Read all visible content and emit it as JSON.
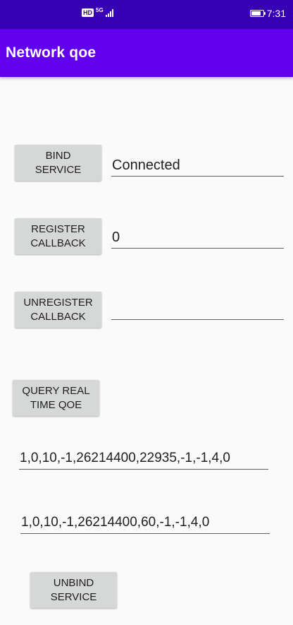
{
  "status_bar": {
    "hd_label": "HD",
    "network_type": "5G",
    "time": "7:31",
    "battery_level": 0.8
  },
  "app_bar": {
    "title": "Network qoe"
  },
  "bind": {
    "button_label": "BIND\nSERVICE",
    "status_value": "Connected"
  },
  "register": {
    "button_label": "REGISTER\nCALLBACK",
    "value": "0"
  },
  "unregister": {
    "button_label": "UNREGISTER\nCALLBACK",
    "value": ""
  },
  "query": {
    "button_label": "QUERY REAL\nTIME QOE",
    "result_1": "1,0,10,-1,26214400,22935,-1,-1,4,0",
    "result_2": "1,0,10,-1,26214400,60,-1,-1,4,0"
  },
  "unbind": {
    "button_label": "UNBIND\nSERVICE"
  }
}
